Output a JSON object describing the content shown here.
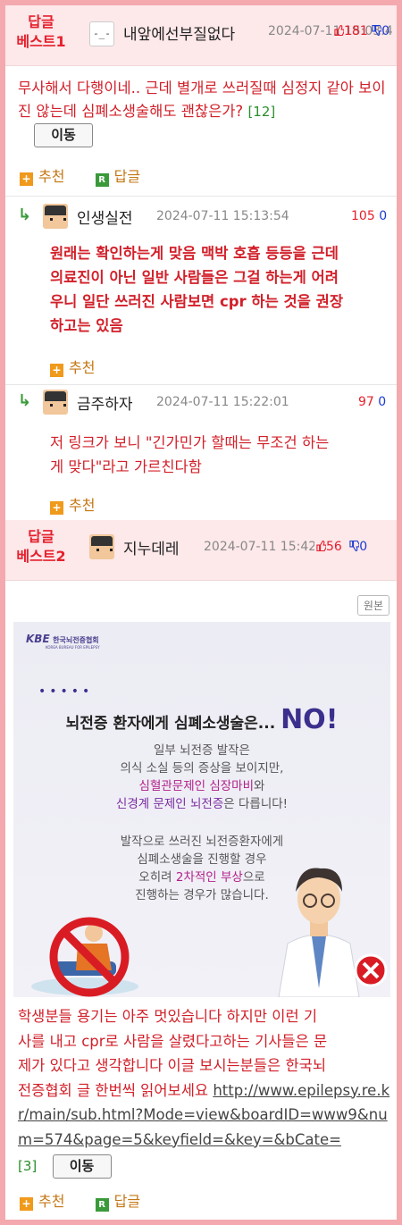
{
  "best1": {
    "badge_line1": "답글",
    "badge_line2": "베스트1",
    "nickname": "내앞에선부질없다",
    "avatar_text": "-_-",
    "time": "2024-07-11 15:03:4",
    "votes_up": "181",
    "votes_down": "0",
    "body": "무사해서 다행이네.. 근데 별개로 쓰러질때 심정지 같아 보이진 않는데 심폐소생술해도 괜찮은가?",
    "reply_count": "[12]",
    "move_label": "이동",
    "recommend_label": "추천",
    "reply_label": "답글"
  },
  "reply1": {
    "nickname": "인생실전",
    "time": "2024-07-11 15:13:54",
    "votes_up": "105",
    "votes_down": "0",
    "body_lines": [
      "원래는 확인하는게 맞음 맥박 호흡 등등을 근데",
      "의료진이 아닌 일반 사람들은 그걸 하는게 어려",
      "우니 일단 쓰러진 사람보면 cpr 하는 것을 권장",
      "하고는 있음"
    ],
    "recommend_label": "추천"
  },
  "reply2": {
    "nickname": "금주하자",
    "time": "2024-07-11 15:22:01",
    "votes_up": "97",
    "votes_down": "0",
    "body_lines": [
      "저 링크가 보니 \"긴가민가 할때는 무조건 하는",
      "게 맞다\"라고 가르친다함"
    ],
    "recommend_label": "추천"
  },
  "best2": {
    "badge_line1": "답글",
    "badge_line2": "베스트2",
    "nickname": "지누데레",
    "time": "2024-07-11 15:42:36",
    "votes_up": "56",
    "votes_down": "0",
    "original_label": "원본",
    "image": {
      "org_name": "한국뇌전증협회",
      "org_sub": "KOREA BUREAU FOR EPILEPSY",
      "logo": "KBE",
      "headline": "뇌전증 환자에게 심폐소생술은...",
      "headline_no": "NO!",
      "para1_line1": "일부 뇌전증 발작은",
      "para1_line2": "의식 소실 등의 증상을 보이지만,",
      "para1_line3a": "심혈관문제인 심장마비",
      "para1_line3b": "와",
      "para1_line4a": "신경계 문제인 뇌전증",
      "para1_line4b": "은 다릅니다!",
      "para2_line1": "발작으로 쓰러진 뇌전증환자에게",
      "para2_line2": "심폐소생술을 진행할 경우",
      "para2_line3a": "오히려 ",
      "para2_line3b": "2차적인 부상",
      "para2_line3c": "으로",
      "para2_line4": "진행하는 경우가 많습니다."
    },
    "body_lines": [
      "학생분들 용기는 아주 멋있습니다 하지만 이런 기",
      "사를 내고 cpr로 사람을 살렸다고하는 기사들은 문",
      "제가 있다고 생각합니다 이글 보시는분들은 한국뇌",
      "전증협회 글 한번씩 읽어보세요"
    ],
    "link_part1": "http://www.epilepsy.re.kr/main/sub.html?Mode=view&boardID=www9&num=574&page=5&keyfield=&key=&bCate=",
    "reply_count": "[3]",
    "move_label": "이동",
    "recommend_label": "추천",
    "reply_label": "답글"
  }
}
